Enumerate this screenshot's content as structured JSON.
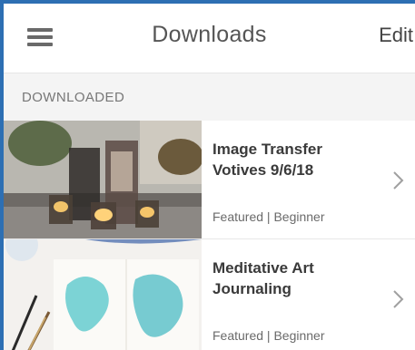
{
  "header": {
    "menu_icon": "hamburger-menu-icon",
    "title": "Downloads",
    "edit_label": "Edit"
  },
  "section": {
    "label": "DOWNLOADED"
  },
  "items": [
    {
      "title": "Image Transfer Votives 9/6/18",
      "meta": "Featured | Beginner",
      "thumbnail": "votive-candles-photo",
      "chevron_icon": "chevron-right-icon"
    },
    {
      "title": "Meditative Art Journaling",
      "meta": "Featured | Beginner",
      "thumbnail": "watercolor-journal-photo",
      "chevron_icon": "chevron-right-icon"
    }
  ],
  "colors": {
    "accent_border": "#2d6fb3",
    "section_bg": "#f4f4f4"
  }
}
